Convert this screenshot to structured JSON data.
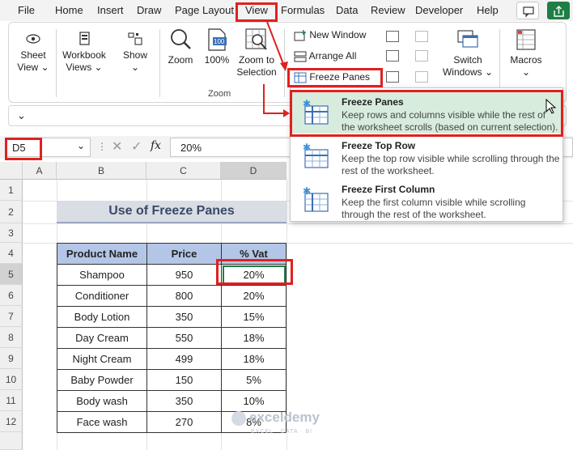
{
  "menubar": {
    "tabs": [
      "File",
      "Home",
      "Insert",
      "Draw",
      "Page Layout",
      "View",
      "Formulas",
      "Data",
      "Review",
      "Developer",
      "Help"
    ]
  },
  "ribbon": {
    "sheet_view_1": "Sheet",
    "sheet_view_2": "View",
    "workbook_views_1": "Workbook",
    "workbook_views_2": "Views",
    "show": "Show",
    "zoom": "Zoom",
    "zoom_100": "100%",
    "zoom_to_selection_1": "Zoom to",
    "zoom_to_selection_2": "Selection",
    "zoom_group": "Zoom",
    "new_window": "New Window",
    "arrange_all": "Arrange All",
    "freeze_panes": "Freeze Panes",
    "switch_windows_1": "Switch",
    "switch_windows_2": "Windows",
    "macros": "Macros"
  },
  "formula_bar": {
    "name_box": "D5",
    "fx": "fx",
    "value": "20%"
  },
  "dropdown": {
    "items": [
      {
        "title": "Freeze Panes",
        "desc": "Keep rows and columns visible while the rest of the worksheet scrolls (based on current selection)."
      },
      {
        "title": "Freeze Top Row",
        "desc": "Keep the top row visible while scrolling through the rest of the worksheet."
      },
      {
        "title": "Freeze First Column",
        "desc": "Keep the first column visible while scrolling through the rest of the worksheet."
      }
    ]
  },
  "grid": {
    "columns": [
      "A",
      "B",
      "C",
      "D"
    ],
    "rows": [
      "1",
      "2",
      "3",
      "4",
      "5",
      "6",
      "7",
      "8",
      "9",
      "10",
      "11",
      "12"
    ]
  },
  "sheet": {
    "title": "Use of Freeze Panes",
    "headers": [
      "Product Name",
      "Price",
      "% Vat"
    ],
    "rows": [
      [
        "Shampoo",
        "950",
        "20%"
      ],
      [
        "Conditioner",
        "800",
        "20%"
      ],
      [
        "Body Lotion",
        "350",
        "15%"
      ],
      [
        "Day Cream",
        "550",
        "18%"
      ],
      [
        "Night Cream",
        "499",
        "18%"
      ],
      [
        "Baby Powder",
        "150",
        "5%"
      ],
      [
        "Body wash",
        "350",
        "10%"
      ],
      [
        "Face wash",
        "270",
        "8%"
      ]
    ]
  },
  "watermark": {
    "name": "exceldemy",
    "tagline": "EXCEL · DATA · BI"
  },
  "colors": {
    "accent_red": "#e02020",
    "header_blue": "#b4c6e7",
    "hover_green": "#d7ecdc",
    "excel_green": "#1e7e45"
  }
}
